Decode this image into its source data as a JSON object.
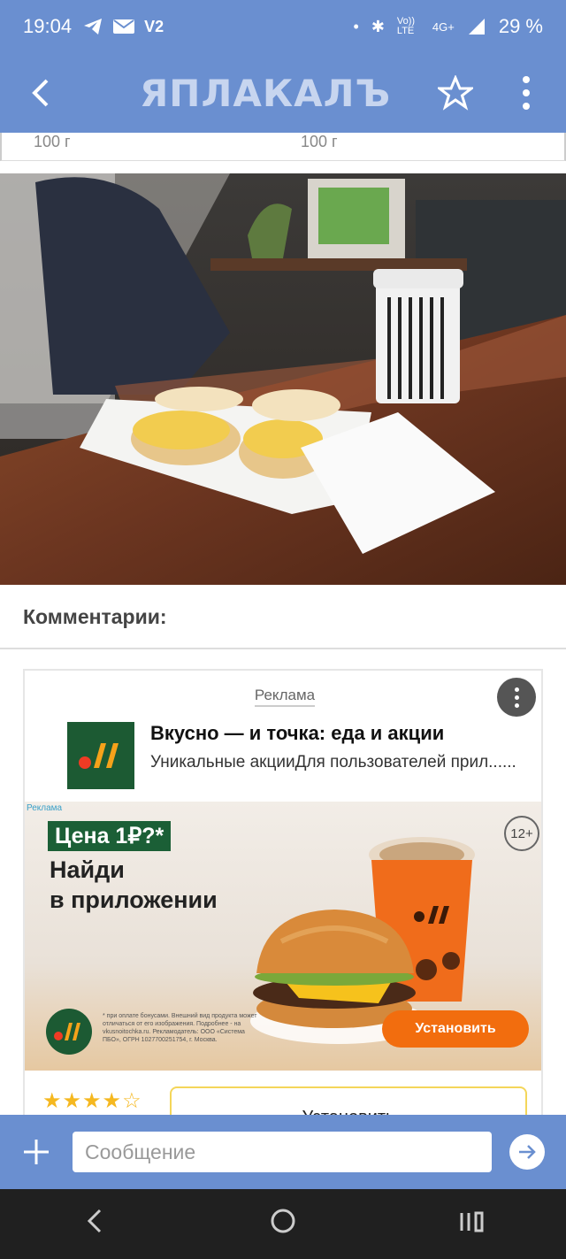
{
  "status_bar": {
    "time": "19:04",
    "v2_label": "V2",
    "network": "4G+",
    "volte": "Vo)) LTE",
    "battery": "29 %"
  },
  "app_bar": {
    "logo_text": "ЯПЛАКАЛЪ",
    "back_icon": "back-arrow-icon",
    "star_icon": "star-icon",
    "menu_icon": "more-vert-icon"
  },
  "post": {
    "weight_left": "100 г",
    "weight_right": "100 г",
    "photo_alt": "cafe-table-photo"
  },
  "comments": {
    "heading": "Комментарии:"
  },
  "ad": {
    "label": "Реклама",
    "title": "Вкусно — и точка: еда и акции",
    "description": "Уникальные акцииДля пользователей прил......",
    "banner": {
      "price_badge": "Цена 1₽?*",
      "headline_1": "Найди",
      "headline_2": "в приложении",
      "age": "12+",
      "fine_print": "* при оплате бонусами. Внешний вид продукта может отличаться от его изображения. Подробнее - на vkusnoitochka.ru. Рекламодатель: ООО «Система ПБО», ОГРН 1027700251754, г. Москва.",
      "install_button": "Установить",
      "corner_label": "Реклама"
    },
    "rating_stars": "★★★★☆",
    "rating": 4.5,
    "install_button_2": "Установить"
  },
  "message_bar": {
    "placeholder": "Сообщение"
  },
  "colors": {
    "app_blue": "#6a8fd0",
    "mcd_green": "#1c5a33",
    "orange": "#f26d0e"
  }
}
